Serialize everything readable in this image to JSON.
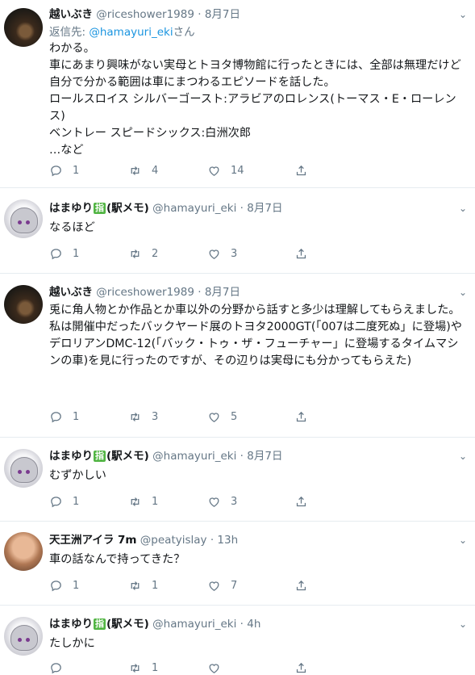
{
  "tweets": [
    {
      "name": "越いぶき",
      "badge": "",
      "name_suffix": "",
      "handle": "@riceshower1989",
      "time": "8月7日",
      "reply_to_prefix": "返信先: ",
      "reply_to_handle": "@hamayuri_eki",
      "reply_to_suffix": "さん",
      "text": "わかる。\n車にあまり興味がない実母とトヨタ博物館に行ったときには、全部は無理だけど自分で分かる範囲は車にまつわるエピソードを話した。\nロールスロイス シルバーゴースト:アラビアのロレンス(トーマス・E・ローレンス)\nベントレー スピードシックス:白洲次郎\n…など",
      "replies": "1",
      "retweets": "4",
      "likes": "14",
      "avatar_icon": "photo-avatar"
    },
    {
      "name": "はまゆり",
      "badge": "指",
      "name_suffix": "(駅メモ)",
      "handle": "@hamayuri_eki",
      "time": "8月7日",
      "text": "なるほど",
      "replies": "1",
      "retweets": "2",
      "likes": "3",
      "avatar_icon": "anime-character-avatar"
    },
    {
      "name": "越いぶき",
      "badge": "",
      "name_suffix": "",
      "handle": "@riceshower1989",
      "time": "8月7日",
      "text": "兎に角人物とか作品とか車以外の分野から話すと多少は理解してもらえました。\n私は開催中だったバックヤード展のトヨタ2000GT(「007は二度死ぬ」に登場)やデロリアンDMC-12(「バック・トゥ・ザ・フューチャー」に登場するタイムマシンの車)を見に行ったのですが、その辺りは実母にも分かってもらえた)",
      "replies": "1",
      "retweets": "3",
      "likes": "5",
      "avatar_icon": "photo-avatar"
    },
    {
      "name": "はまゆり",
      "badge": "指",
      "name_suffix": "(駅メモ)",
      "handle": "@hamayuri_eki",
      "time": "8月7日",
      "text": "むずかしい",
      "replies": "1",
      "retweets": "1",
      "likes": "3",
      "avatar_icon": "anime-character-avatar"
    },
    {
      "name": "天王洲アイラ 7m",
      "badge": "",
      "name_suffix": "",
      "handle": "@peatyislay",
      "time": "13h",
      "text": "車の話なんで持ってきた？",
      "replies": "1",
      "retweets": "1",
      "likes": "7",
      "avatar_icon": "photo-avatar"
    },
    {
      "name": "はまゆり",
      "badge": "指",
      "name_suffix": "(駅メモ)",
      "handle": "@hamayuri_eki",
      "time": "4h",
      "text": "たしかに",
      "replies": "",
      "retweets": "1",
      "likes": "",
      "avatar_icon": "anime-character-avatar"
    }
  ],
  "dot": "·",
  "colors": {
    "link": "#1b95e0",
    "muted": "#657786",
    "text": "#14171a",
    "badge": "#52b544"
  }
}
